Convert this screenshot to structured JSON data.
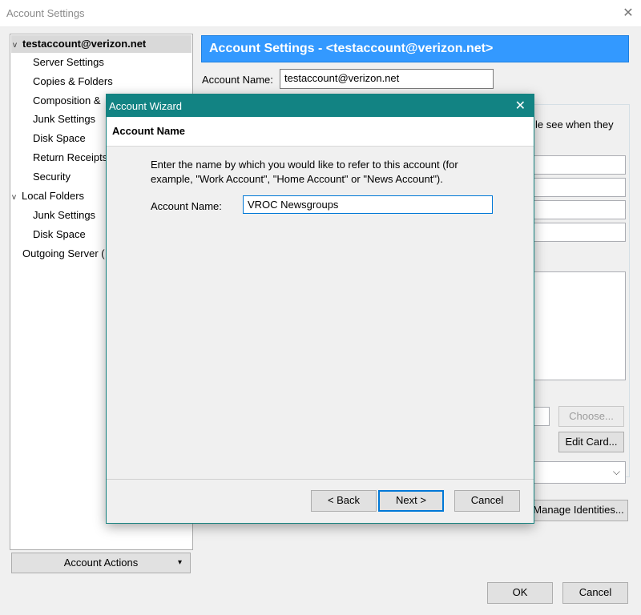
{
  "window": {
    "title": "Account Settings",
    "close_glyph": "✕"
  },
  "tree": {
    "items": [
      {
        "label": "testaccount@verizon.net",
        "twisty": "v"
      },
      {
        "label": "Server Settings"
      },
      {
        "label": "Copies & Folders"
      },
      {
        "label": "Composition &"
      },
      {
        "label": "Junk Settings"
      },
      {
        "label": "Disk Space"
      },
      {
        "label": "Return Receipts"
      },
      {
        "label": "Security"
      },
      {
        "label": "Local Folders",
        "twisty": "v"
      },
      {
        "label": "Junk Settings"
      },
      {
        "label": "Disk Space"
      },
      {
        "label": "Outgoing Server ("
      }
    ],
    "account_actions": {
      "label": "Account Actions",
      "arrow": "▾"
    }
  },
  "right": {
    "header": "Account Settings - <testaccount@verizon.net>",
    "account_name_label": "Account Name:",
    "account_name_value": "testaccount@verizon.net",
    "partial_text": "le see when they",
    "choose_label": "Choose...",
    "edit_card_label": "Edit Card...",
    "dropdown_chevron": "⌵",
    "manage_identities_label": "Manage Identities..."
  },
  "footer": {
    "ok_label": "OK",
    "cancel_label": "Cancel"
  },
  "wizard": {
    "title": "Account Wizard",
    "close_glyph": "✕",
    "heading": "Account Name",
    "description_line1": "Enter the name by which you would like to refer to this account (for",
    "description_line2": "example, \"Work Account\", \"Home Account\" or \"News Account\").",
    "field_label": "Account Name:",
    "field_value": "VROC Newsgroups",
    "back_label": "< Back",
    "next_label": "Next >",
    "cancel_label": "Cancel"
  },
  "colors": {
    "header_blue": "#3399ff",
    "wizard_titlebar": "#128383",
    "focus_border": "#0078d7"
  }
}
